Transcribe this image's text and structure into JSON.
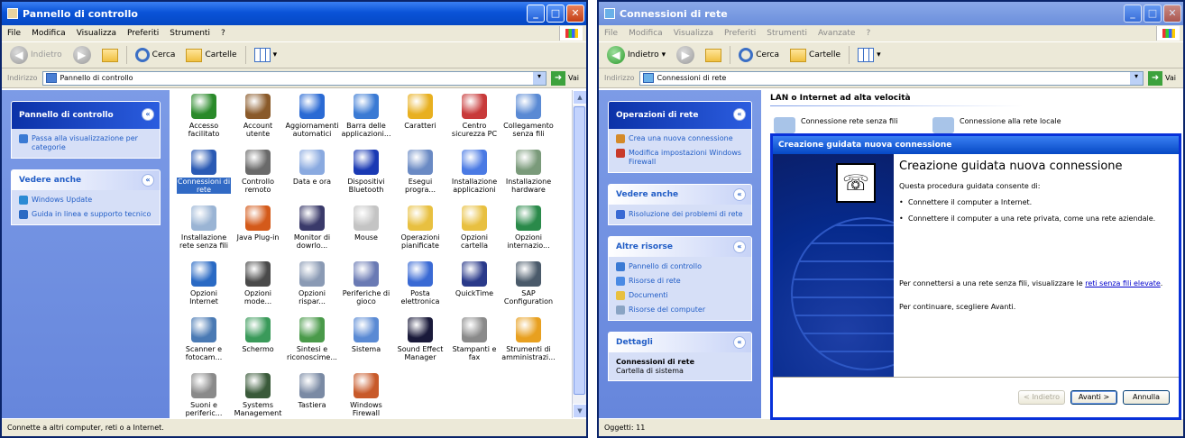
{
  "left_window": {
    "title": "Pannello di controllo",
    "menu": [
      "File",
      "Modifica",
      "Visualizza",
      "Preferiti",
      "Strumenti",
      "?"
    ],
    "toolbar": {
      "back": "Indietro",
      "search": "Cerca",
      "folders": "Cartelle"
    },
    "address_label": "Indirizzo",
    "address_value": "Pannello di controllo",
    "go_label": "Vai",
    "panel_main": {
      "title": "Pannello di controllo",
      "link": "Passa alla visualizzazione per categorie"
    },
    "panel_see_also": {
      "title": "Vedere anche",
      "links": [
        "Windows Update",
        "Guida in linea e supporto tecnico"
      ]
    },
    "items": [
      {
        "label": "Accesso facilitato",
        "color": "#2a8a2a"
      },
      {
        "label": "Account utente",
        "color": "#8a5a2a"
      },
      {
        "label": "Aggiornamenti automatici",
        "color": "#2a6ad4"
      },
      {
        "label": "Barra delle applicazioni...",
        "color": "#3a7ad4"
      },
      {
        "label": "Caratteri",
        "color": "#e8b020"
      },
      {
        "label": "Centro sicurezza PC",
        "color": "#c83a3a"
      },
      {
        "label": "Collegamento senza fili",
        "color": "#5a8ad4"
      },
      {
        "label": "Connessioni di rete",
        "color": "#2a5ab4"
      },
      {
        "label": "Controllo remoto",
        "color": "#6a6a6a"
      },
      {
        "label": "Data e ora",
        "color": "#8aaae0"
      },
      {
        "label": "Dispositivi Bluetooth",
        "color": "#1a3ab4"
      },
      {
        "label": "Esegui progra...",
        "color": "#6a8ac4"
      },
      {
        "label": "Installazione applicazioni",
        "color": "#4a7ae4"
      },
      {
        "label": "Installazione hardware",
        "color": "#7a9a7a"
      },
      {
        "label": "Installazione rete senza fili",
        "color": "#9ab4d4"
      },
      {
        "label": "Java Plug-in",
        "color": "#d45a1a"
      },
      {
        "label": "Monitor di dowrlo...",
        "color": "#3a3a6a"
      },
      {
        "label": "Mouse",
        "color": "#c4c4c4"
      },
      {
        "label": "Operazioni pianificate",
        "color": "#e8c040"
      },
      {
        "label": "Opzioni cartella",
        "color": "#e8c040"
      },
      {
        "label": "Opzioni internazio...",
        "color": "#2a8a4a"
      },
      {
        "label": "Opzioni Internet",
        "color": "#2a6ac4"
      },
      {
        "label": "Opzioni mode...",
        "color": "#4a4a4a"
      },
      {
        "label": "Opzioni rispar...",
        "color": "#8a9ab4"
      },
      {
        "label": "Periferiche di gioco",
        "color": "#6a7ab4"
      },
      {
        "label": "Posta elettronica",
        "color": "#3a6ad4"
      },
      {
        "label": "QuickTime",
        "color": "#2a3a8a"
      },
      {
        "label": "SAP Configuration",
        "color": "#4a5a6a"
      },
      {
        "label": "Scanner e fotocam...",
        "color": "#4a7ab4"
      },
      {
        "label": "Schermo",
        "color": "#3a9a5a"
      },
      {
        "label": "Sintesi e riconoscime...",
        "color": "#4a9a4a"
      },
      {
        "label": "Sistema",
        "color": "#5a8ad4"
      },
      {
        "label": "Sound Effect Manager",
        "color": "#1a1a3a"
      },
      {
        "label": "Stampanti e fax",
        "color": "#8a8a8a"
      },
      {
        "label": "Strumenti di amministrazi...",
        "color": "#e8a020"
      },
      {
        "label": "Suoni e periferic...",
        "color": "#8a8a8a"
      },
      {
        "label": "Systems Management",
        "color": "#3a5a3a"
      },
      {
        "label": "Tastiera",
        "color": "#7a8aa4"
      },
      {
        "label": "Windows Firewall",
        "color": "#c85a2a"
      }
    ],
    "selected_index": 7,
    "status": "Connette a altri computer, reti o a Internet."
  },
  "right_window": {
    "title": "Connessioni di rete",
    "menu": [
      "File",
      "Modifica",
      "Visualizza",
      "Preferiti",
      "Strumenti",
      "Avanzate",
      "?"
    ],
    "toolbar": {
      "back": "Indietro",
      "search": "Cerca",
      "folders": "Cartelle"
    },
    "address_label": "Indirizzo",
    "address_value": "Connessioni di rete",
    "go_label": "Vai",
    "panel_ops": {
      "title": "Operazioni di rete",
      "links": [
        "Crea una nuova connessione",
        "Modifica impostazioni Windows Firewall"
      ]
    },
    "panel_see_also": {
      "title": "Vedere anche",
      "links": [
        "Risoluzione dei problemi di rete"
      ]
    },
    "panel_other": {
      "title": "Altre risorse",
      "links": [
        "Pannello di controllo",
        "Risorse di rete",
        "Documenti",
        "Risorse del computer"
      ]
    },
    "panel_details": {
      "title": "Dettagli",
      "name": "Connessioni di rete",
      "sub": "Cartella di sistema"
    },
    "section_title": "LAN o Internet ad alta velocità",
    "connections": [
      "Connessione rete senza fili",
      "Connessione alla rete locale"
    ],
    "status": "Oggetti: 11",
    "dialog": {
      "title": "Creazione guidata nuova connessione",
      "heading": "Creazione guidata nuova connessione",
      "intro": "Questa procedura guidata consente di:",
      "bullets": [
        "Connettere il computer a Internet.",
        "Connettere il computer a una rete privata, come una rete aziendale."
      ],
      "wireless_pre": "Per connettersi a una rete senza fili, visualizzare le",
      "wireless_link": "reti senza fili elevate",
      "continue": "Per continuare, scegliere Avanti.",
      "buttons": {
        "back": "< Indietro",
        "next": "Avanti >",
        "cancel": "Annulla"
      }
    }
  }
}
